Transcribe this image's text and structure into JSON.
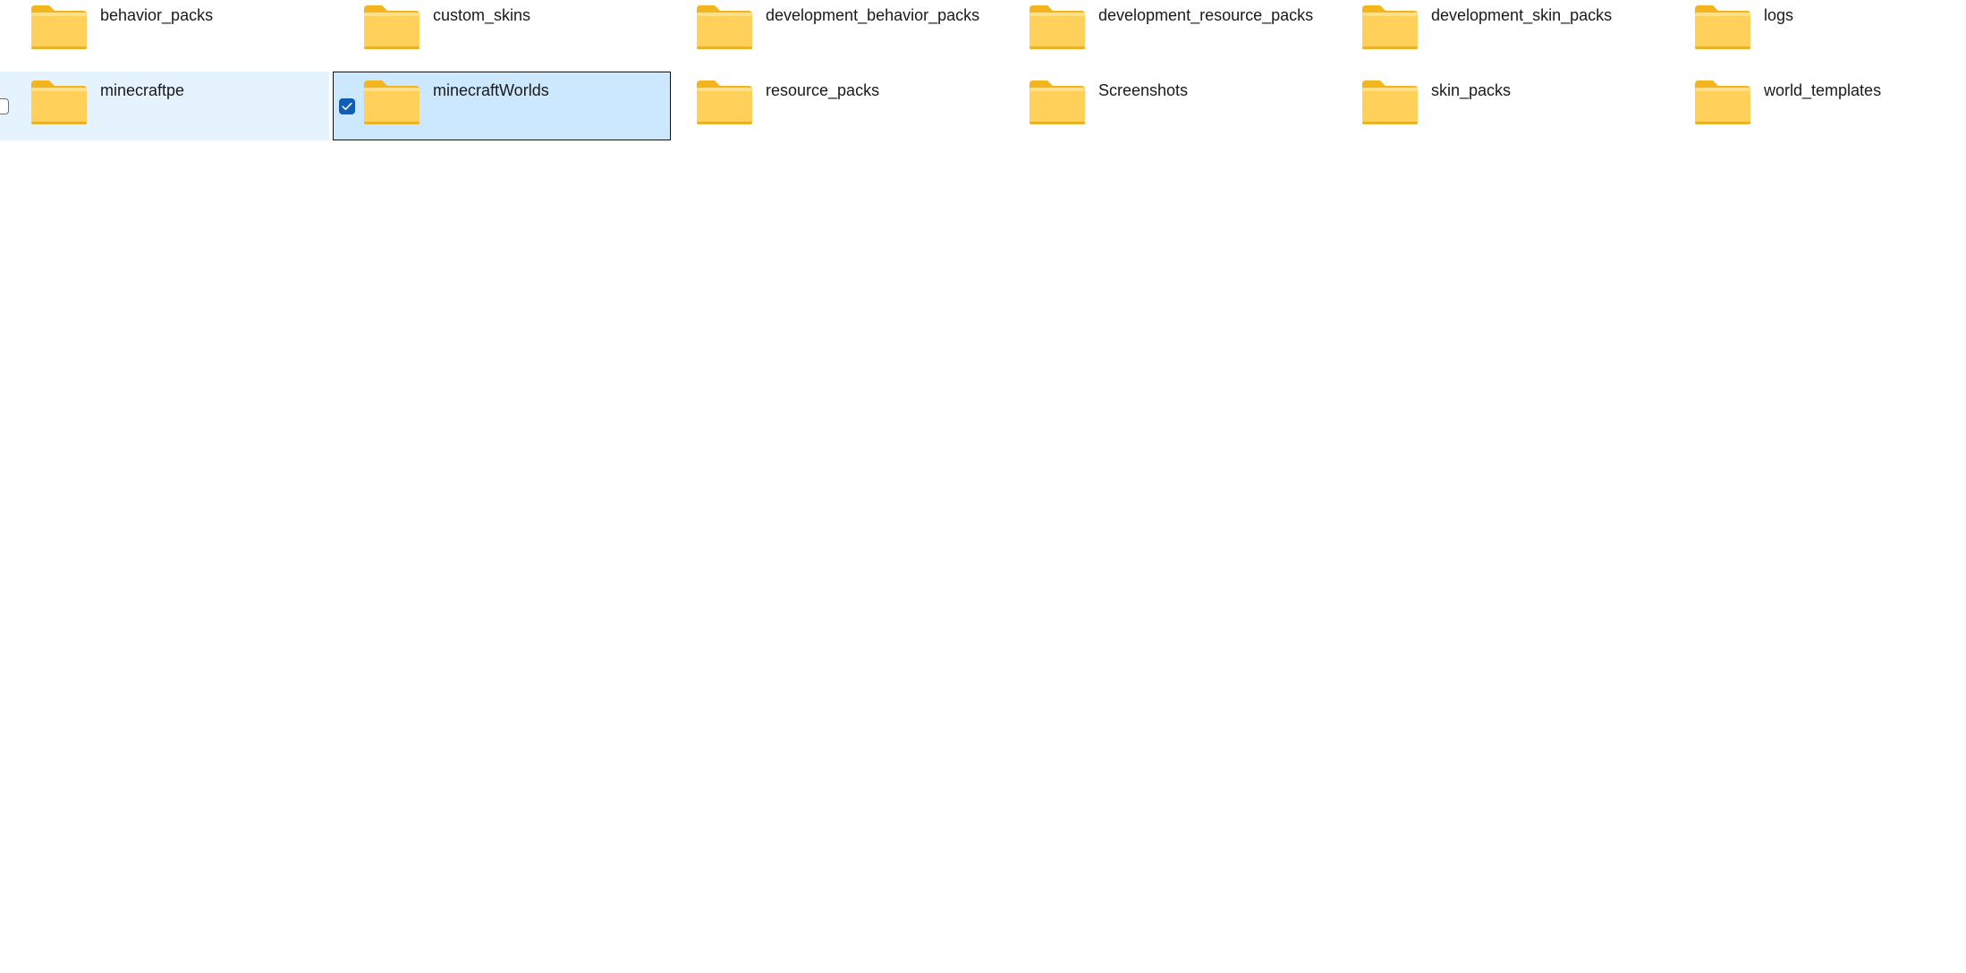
{
  "folders": [
    {
      "name": "behavior_packs",
      "state": "normal"
    },
    {
      "name": "custom_skins",
      "state": "normal"
    },
    {
      "name": "development_behavior_packs",
      "state": "normal"
    },
    {
      "name": "development_resource_packs",
      "state": "normal"
    },
    {
      "name": "development_skin_packs",
      "state": "normal"
    },
    {
      "name": "logs",
      "state": "normal"
    },
    {
      "name": "minecraftpe",
      "state": "hover"
    },
    {
      "name": "minecraftWorlds",
      "state": "selected"
    },
    {
      "name": "resource_packs",
      "state": "normal"
    },
    {
      "name": "Screenshots",
      "state": "normal"
    },
    {
      "name": "skin_packs",
      "state": "normal"
    },
    {
      "name": "world_templates",
      "state": "normal"
    }
  ],
  "icons": {
    "folder": "folder-icon",
    "check": "checkbox-icon"
  },
  "colors": {
    "folder_front": "#ffd05a",
    "folder_back": "#f2b51d",
    "hover_bg": "#e5f3ff",
    "selected_bg": "#cce8ff",
    "checkbox_checked": "#0f5fb8"
  }
}
